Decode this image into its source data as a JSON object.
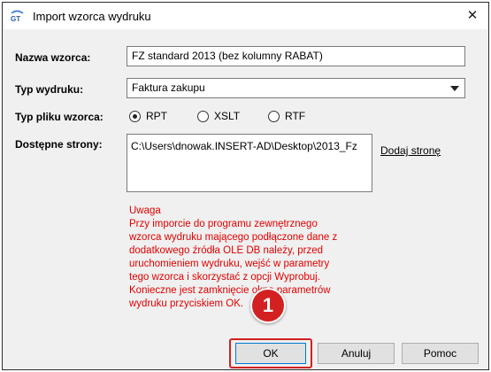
{
  "window": {
    "title": "Import wzorca wydruku",
    "close_glyph": "✕"
  },
  "form": {
    "name_label": "Nazwa wzorca:",
    "name_value": "FZ standard 2013 (bez kolumny RABAT)",
    "type_label": "Typ wydruku:",
    "type_value": "Faktura zakupu",
    "file_type_label": "Typ pliku wzorca:",
    "file_types": [
      {
        "label": "RPT",
        "checked": true
      },
      {
        "label": "XSLT",
        "checked": false
      },
      {
        "label": "RTF",
        "checked": false
      }
    ],
    "pages_label": "Dostępne strony:",
    "pages_value": "C:\\Users\\dnowak.INSERT-AD\\Desktop\\2013_Fz",
    "add_page_link": "Dodaj stronę"
  },
  "warning": {
    "title": "Uwaga",
    "lines": [
      "Przy imporcie do programu zewnętrznego",
      "wzorca wydruku mającego podłączone dane z",
      "dodatkowego źródła OLE DB należy, przed",
      "uruchomieniem wydruku, wejść w parametry",
      "tego wzorca i skorzystać z opcji Wyprobuj.",
      "Konieczne jest zamknięcie okna parametrów",
      "wydruku przyciskiem OK."
    ]
  },
  "buttons": {
    "ok": "OK",
    "cancel": "Anuluj",
    "help": "Pomoc"
  },
  "annotation": {
    "step_number": "1"
  },
  "colors": {
    "warning_text": "#e00000",
    "highlight": "#d32020"
  }
}
